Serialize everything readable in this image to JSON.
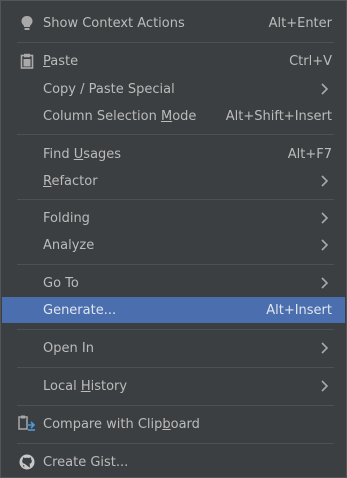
{
  "menu": {
    "items": {
      "show_context_actions": {
        "label": "Show Context Actions",
        "shortcut": "Alt+Enter",
        "icon": "lightbulb-icon"
      },
      "paste": {
        "label_pre": "",
        "label_mn": "P",
        "label_post": "aste",
        "shortcut": "Ctrl+V",
        "icon": "clipboard-icon"
      },
      "copy_paste_special": {
        "label": "Copy / Paste Special"
      },
      "column_selection_mode": {
        "label_pre": "Column Selection ",
        "label_mn": "M",
        "label_post": "ode",
        "shortcut": "Alt+Shift+Insert"
      },
      "find_usages": {
        "label_pre": "Find ",
        "label_mn": "U",
        "label_post": "sages",
        "shortcut": "Alt+F7"
      },
      "refactor": {
        "label_pre": "",
        "label_mn": "R",
        "label_post": "efactor"
      },
      "folding": {
        "label": "Folding"
      },
      "analyze": {
        "label": "Analyze"
      },
      "go_to": {
        "label": "Go To"
      },
      "generate": {
        "label": "Generate...",
        "shortcut": "Alt+Insert"
      },
      "open_in": {
        "label": "Open In"
      },
      "local_history": {
        "label_pre": "Local ",
        "label_mn": "H",
        "label_post": "istory"
      },
      "compare_with_clipboard": {
        "label_pre": "Compare with Clip",
        "label_mn": "b",
        "label_post": "oard",
        "icon": "compare-icon"
      },
      "create_gist": {
        "label": "Create Gist...",
        "icon": "github-icon"
      }
    }
  },
  "colors": {
    "background": "#3c3f41",
    "selection": "#4b6eaf",
    "text": "#bbbbbb",
    "separator": "#4d5153"
  }
}
